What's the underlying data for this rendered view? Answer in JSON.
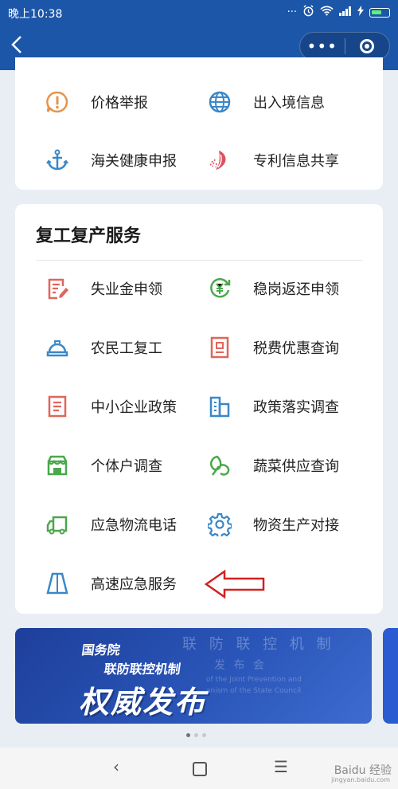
{
  "status_bar": {
    "time": "晚上10:38",
    "icons": [
      "signal-dots-icon",
      "alarm-icon",
      "wifi-icon",
      "cell-signal-icon",
      "charging-icon",
      "battery-icon"
    ]
  },
  "nav": {
    "back_icon": "chevron-left-icon",
    "more_icon": "more-dots-icon",
    "close_icon": "target-icon"
  },
  "card1": {
    "items": [
      {
        "label": "价格举报",
        "icon": "exclaim-circle-icon",
        "color": "#e8924a"
      },
      {
        "label": "出入境信息",
        "icon": "globe-icon",
        "color": "#3a88c8"
      },
      {
        "label": "海关健康申报",
        "icon": "anchor-icon",
        "color": "#3a88c8"
      },
      {
        "label": "专利信息共享",
        "icon": "patent-icon",
        "color": "#e05060"
      }
    ]
  },
  "card2": {
    "title": "复工复产服务",
    "items": [
      {
        "label": "失业金申领",
        "icon": "edit-doc-icon",
        "color": "#e0665a"
      },
      {
        "label": "稳岗返还申领",
        "icon": "yuan-return-icon",
        "color": "#4aa84a"
      },
      {
        "label": "农民工复工",
        "icon": "hardhat-icon",
        "color": "#3a88c8"
      },
      {
        "label": "税费优惠查询",
        "icon": "tax-card-icon",
        "color": "#e0665a"
      },
      {
        "label": "中小企业政策",
        "icon": "document-icon",
        "color": "#e0665a"
      },
      {
        "label": "政策落实调查",
        "icon": "buildings-icon",
        "color": "#3a88c8"
      },
      {
        "label": "个体户调查",
        "icon": "shop-icon",
        "color": "#4aa84a"
      },
      {
        "label": "蔬菜供应查询",
        "icon": "vegetable-icon",
        "color": "#4aa84a"
      },
      {
        "label": "应急物流电话",
        "icon": "truck-icon",
        "color": "#4aa84a"
      },
      {
        "label": "物资生产对接",
        "icon": "gear-icon",
        "color": "#3a88c8"
      },
      {
        "label": "高速应急服务",
        "icon": "highway-icon",
        "color": "#3a88c8"
      }
    ]
  },
  "banner": {
    "line1": "国务院",
    "line2": "联防联控机制",
    "big": "权威发布",
    "bg_line1": "联 防 联 控 机 制",
    "bg_line2": "发 布 会",
    "bg_en1": "of the Joint Prevention and",
    "bg_en2": "anism of the State Council"
  },
  "carousel": {
    "count": 3,
    "active": 0
  },
  "system_nav": {
    "back": "‹",
    "menu": "☰"
  },
  "watermark": {
    "text": "Baidu 经验",
    "sub": "jingyan.baidu.com"
  },
  "colors": {
    "brand_blue": "#1c56a8",
    "annotation_red": "#d42020"
  }
}
